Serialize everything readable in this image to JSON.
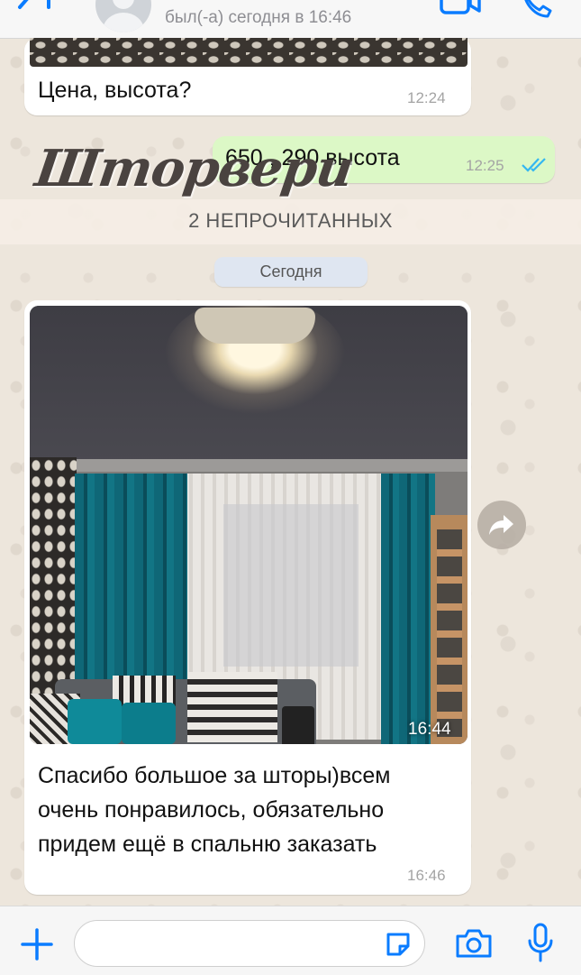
{
  "header": {
    "status": "был(-а) сегодня в 16:46"
  },
  "messages": {
    "m1": {
      "text": "Цена, высота?",
      "time": "12:24"
    },
    "m2": {
      "text": "650 , 290 высота",
      "time": "12:25"
    },
    "m3": {
      "photo_time": "16:44",
      "text_line1": "Спасибо большое за шторы)всем",
      "text_line2": "очень понравилось, обязательно",
      "text_line3": "придем ещё в спальню заказать",
      "time": "16:46"
    }
  },
  "unread_banner": "2 НЕПРОЧИТАННЫХ",
  "date_separator": "Сегодня",
  "watermark": "Шторвери",
  "input": {
    "placeholder": ""
  },
  "colors": {
    "accent": "#0a7cff",
    "outgoing_bubble": "#dcf8c6",
    "incoming_bubble": "#ffffff",
    "read_ticks": "#34b7f1"
  },
  "icons": [
    "back-icon",
    "avatar",
    "video-call-icon",
    "phone-icon",
    "forward-icon",
    "plus-icon",
    "sticker-icon",
    "camera-icon",
    "mic-icon",
    "double-check-icon"
  ]
}
